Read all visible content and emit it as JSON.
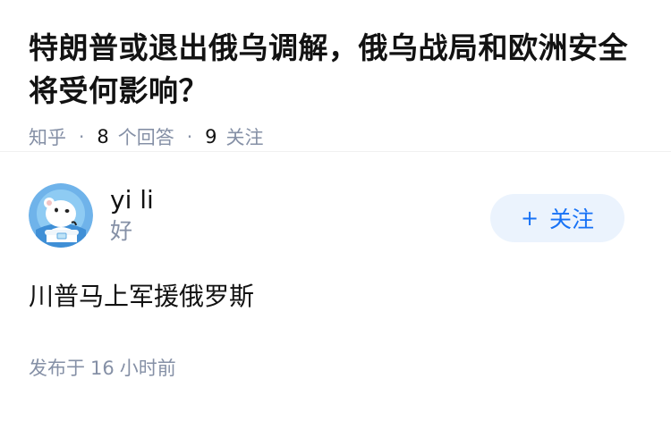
{
  "question": {
    "title": "特朗普或退出俄乌调解，俄乌战局和欧洲安全将受何影响？",
    "source": "知乎",
    "answer_count": "8",
    "answer_label": "个回答",
    "follow_count": "9",
    "follow_label": "关注"
  },
  "answer": {
    "author_name": "yi li",
    "author_bio": "好",
    "follow_button": {
      "icon": "+",
      "label": "关注"
    },
    "content": "川普马上军援俄罗斯",
    "time_prefix": "发布于",
    "time_value": "16",
    "time_suffix": "小时前"
  },
  "colors": {
    "title": "#121212",
    "meta": "#8590a6",
    "accent": "#1772f6",
    "button_bg": "#ebf3fd"
  },
  "icons": {
    "avatar": "polar-bear-avatar-icon"
  }
}
